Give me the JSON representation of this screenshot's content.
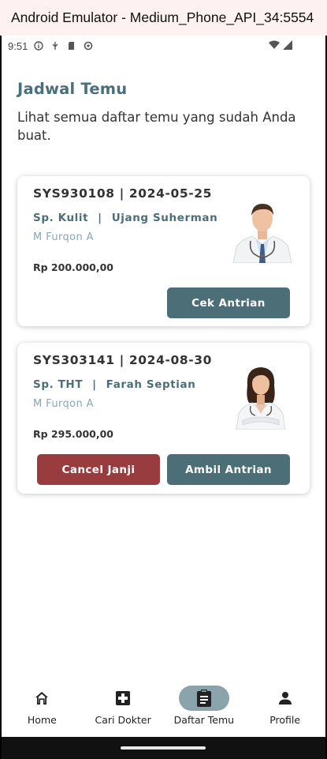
{
  "window": {
    "title": "Android Emulator - Medium_Phone_API_34:5554"
  },
  "status_bar": {
    "time": "9:51"
  },
  "header": {
    "title": "Jadwal Temu",
    "subtitle": "Lihat semua daftar temu yang sudah Anda buat."
  },
  "appointments": [
    {
      "code_date": "SYS930108 | 2024-05-25",
      "specialty": "Sp. Kulit",
      "separator": "|",
      "doctor": "Ujang Suherman",
      "patient": "M Furqon A",
      "price": "Rp 200.000,00",
      "primary_button": "Cek Antrian"
    },
    {
      "code_date": "SYS303141 | 2024-08-30",
      "specialty": "Sp. THT",
      "separator": "|",
      "doctor": "Farah Septian",
      "patient": "M Furqon A",
      "price": "Rp 295.000,00",
      "cancel_button": "Cancel Janji",
      "primary_button": "Ambil Antrian"
    }
  ],
  "bottom_nav": {
    "items": [
      {
        "label": "Home",
        "icon": "home-icon"
      },
      {
        "label": "Cari Dokter",
        "icon": "medical-cross-icon"
      },
      {
        "label": "Daftar Temu",
        "icon": "clipboard-icon",
        "active": true
      },
      {
        "label": "Profile",
        "icon": "person-icon"
      }
    ]
  },
  "colors": {
    "accent": "#4c6e77",
    "danger": "#983c3f",
    "active_pill": "#8ba3aa",
    "title": "#4b6f7a"
  }
}
